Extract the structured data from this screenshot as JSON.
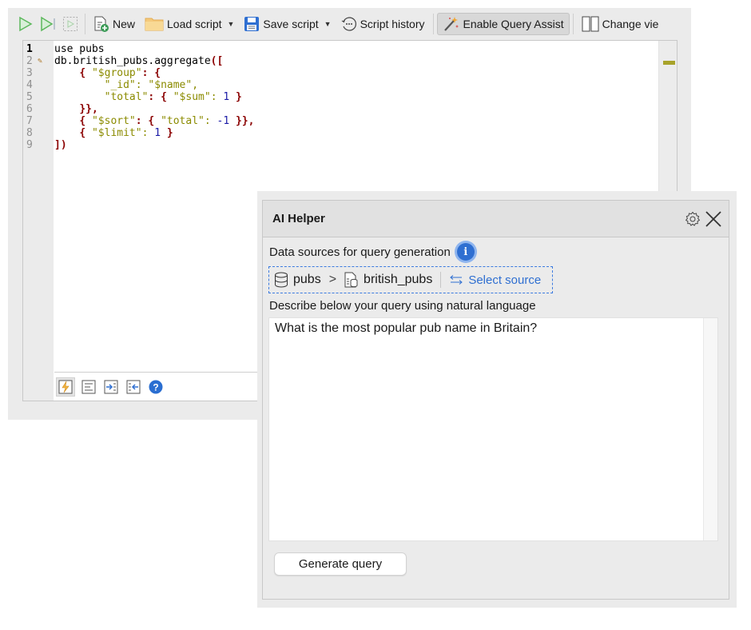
{
  "toolbar": {
    "run_icon": "run-icon",
    "run_line_icon": "run-to-line-icon",
    "run_selection_icon": "run-selection-icon",
    "new_label": "New",
    "load_label": "Load script",
    "save_label": "Save script",
    "history_label": "Script history",
    "query_assist_label": "Enable Query Assist",
    "change_view_label": "Change vie"
  },
  "editor": {
    "line_numbers": [
      "1",
      "2",
      "3",
      "4",
      "5",
      "6",
      "7",
      "8",
      "9"
    ],
    "current_line": 1,
    "modified_line": 2,
    "lines": [
      [
        {
          "t": "plain",
          "v": "use pubs"
        }
      ],
      [
        {
          "t": "plain",
          "v": "db.british_pubs.aggregate"
        },
        {
          "t": "brace",
          "v": "(["
        }
      ],
      [
        {
          "t": "plain",
          "v": "    "
        },
        {
          "t": "brace",
          "v": "{ "
        },
        {
          "t": "str",
          "v": "\"$group\""
        },
        {
          "t": "brace",
          "v": ": {"
        }
      ],
      [
        {
          "t": "plain",
          "v": "        "
        },
        {
          "t": "str",
          "v": "\"_id\": \"$name\","
        }
      ],
      [
        {
          "t": "plain",
          "v": "        "
        },
        {
          "t": "str",
          "v": "\"total\""
        },
        {
          "t": "brace",
          "v": ": { "
        },
        {
          "t": "str",
          "v": "\"$sum\": "
        },
        {
          "t": "num",
          "v": "1"
        },
        {
          "t": "brace",
          "v": " }"
        }
      ],
      [
        {
          "t": "plain",
          "v": "    "
        },
        {
          "t": "brace",
          "v": "}},"
        }
      ],
      [
        {
          "t": "plain",
          "v": "    "
        },
        {
          "t": "brace",
          "v": "{ "
        },
        {
          "t": "str",
          "v": "\"$sort\""
        },
        {
          "t": "brace",
          "v": ": { "
        },
        {
          "t": "str",
          "v": "\"total\": "
        },
        {
          "t": "num",
          "v": "-1"
        },
        {
          "t": "brace",
          "v": " }},"
        }
      ],
      [
        {
          "t": "plain",
          "v": "    "
        },
        {
          "t": "brace",
          "v": "{ "
        },
        {
          "t": "str",
          "v": "\"$limit\": "
        },
        {
          "t": "num",
          "v": "1"
        },
        {
          "t": "brace",
          "v": " }"
        }
      ],
      [
        {
          "t": "brace",
          "v": "])"
        }
      ]
    ],
    "bottom_icons": [
      "query-code-icon",
      "format-text-icon",
      "indent-icon",
      "outdent-icon",
      "help-icon"
    ]
  },
  "ai_helper": {
    "title": "AI Helper",
    "data_sources_label": "Data sources for query generation",
    "info_badge": "i",
    "database": "pubs",
    "breadcrumb_separator": ">",
    "collection": "british_pubs",
    "select_source_label": "Select source",
    "describe_label": "Describe below your query using natural language",
    "query_text": "What is the most popular pub name in Britain?",
    "generate_label": "Generate query"
  },
  "colors": {
    "accent_blue": "#2f6fd1",
    "run_green": "#5cb85c",
    "code_brace": "#8b0000",
    "code_string": "#8b8b00",
    "code_number": "#1a1aa6",
    "ruler_mark": "#a8a32a"
  }
}
